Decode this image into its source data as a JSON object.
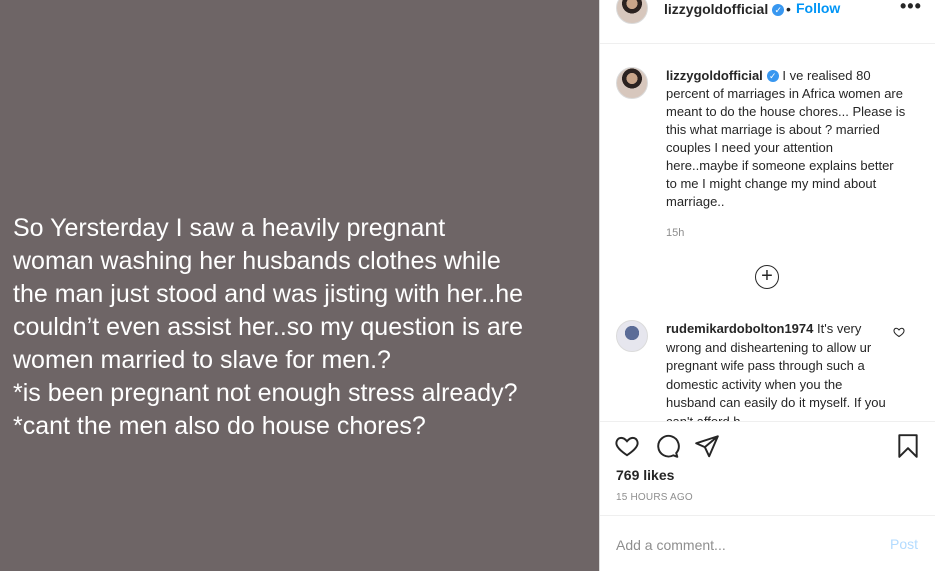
{
  "post": {
    "image_text": "So Yersterday I saw a heavily pregnant\nwoman washing her husbands clothes while\nthe man just stood and was jisting with her..he\ncouldn’t even assist her..so my question is are\nwomen married to slave for men.?\n*is been pregnant not enough stress already?\n*cant the men also do house chores?"
  },
  "header": {
    "username": "lizzygoldofficial",
    "verified_mark": "✓",
    "separator": "•",
    "follow_label": "Follow",
    "more_label": "•••"
  },
  "caption": {
    "username": "lizzygoldofficial",
    "verified_mark": "✓",
    "text": "I ve realised 80 percent of marriages in Africa women are meant to do the house chores... Please is this what marriage is about ? married couples I need your attention here..maybe if someone explains better to me I might change my mind about marriage..",
    "time": "15h"
  },
  "load_more": {
    "icon": "plus-circle-icon",
    "label": "+"
  },
  "comment": {
    "username": "rudemikardobolton1974",
    "text": "It's very wrong and disheartening to allow ur pregnant wife pass through such a domestic activity when you the husband can easily do it myself. If you can't afford h..."
  },
  "actions": {
    "icons": [
      "heart-icon",
      "comment-icon",
      "share-icon",
      "bookmark-icon"
    ]
  },
  "likes": "769 likes",
  "timestamp": "15 HOURS AGO",
  "add_comment": {
    "placeholder": "Add a comment...",
    "post_label": "Post"
  },
  "colors": {
    "image_bg": "#6e6566",
    "accent": "#0095f6",
    "verified": "#3897f0",
    "post_disabled": "#b3dbff"
  }
}
